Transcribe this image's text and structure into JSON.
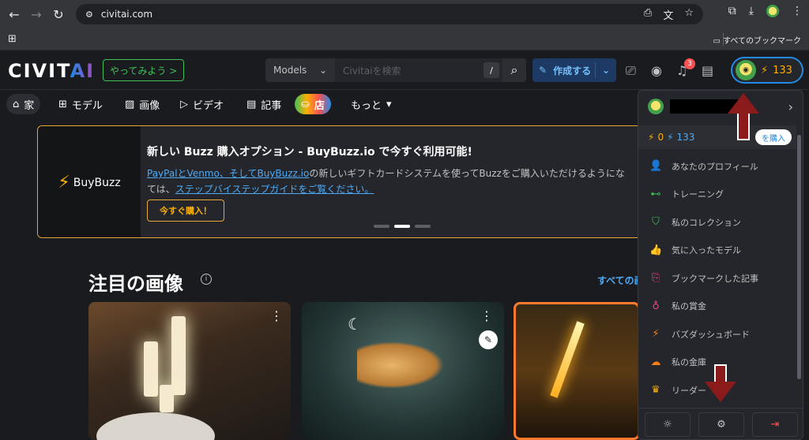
{
  "browser": {
    "url": "civitai.com",
    "bookmarks_all": "すべてのブックマーク"
  },
  "header": {
    "logo_main": "CIVIT",
    "logo_ai": "AI",
    "try_button": "やってみよう >",
    "search_type": "Models",
    "search_placeholder": "Civitaiを検索",
    "search_kbd": "/",
    "create_button": "作成する",
    "notification_count": "3",
    "buzz_amount": "133"
  },
  "nav": {
    "home": "家",
    "models": "モデル",
    "images": "画像",
    "videos": "ビデオ",
    "articles": "記事",
    "shop": "店",
    "more": "もっと"
  },
  "banner": {
    "brand": "BuyBuzz",
    "title": "新しい Buzz 購入オプション - BuyBuzz.io で今すぐ利用可能!",
    "link1": "PayPalとVenmo、そしてBuyBuzz.io",
    "text1": "の新しいギフトカードシステムを使ってBuzzをご購入いただけるようにな",
    "text2": "ては、",
    "link2": "ステップバイステップガイドをご覧ください。",
    "button": "今すぐ購入！"
  },
  "featured": {
    "title": "注目の画像",
    "see_all": "すべての画"
  },
  "dropdown": {
    "buzz_yellow": "0",
    "buzz_blue": "133",
    "buy_button": "を購入",
    "items": [
      {
        "label": "あなたのプロフィール",
        "icon": "user-icon",
        "color": "#4dabf7"
      },
      {
        "label": "トレーニング",
        "icon": "barbell-icon",
        "color": "#40c057"
      },
      {
        "label": "私のコレクション",
        "icon": "bookmark-icon",
        "color": "#40c057"
      },
      {
        "label": "気に入ったモデル",
        "icon": "thumb-up-icon",
        "color": "#40c057"
      },
      {
        "label": "ブックマークした記事",
        "icon": "article-bookmark-icon",
        "color": "#e64980"
      },
      {
        "label": "私の賞金",
        "icon": "moneybag-icon",
        "color": "#e64980"
      },
      {
        "label": "バズダッシュボード",
        "icon": "bolt-circle-icon",
        "color": "#fd7e14"
      },
      {
        "label": "私の金庫",
        "icon": "cloud-lock-icon",
        "color": "#fd7e14"
      },
      {
        "label": "リーダー",
        "icon": "crown-icon",
        "color": "#fab005"
      }
    ]
  }
}
